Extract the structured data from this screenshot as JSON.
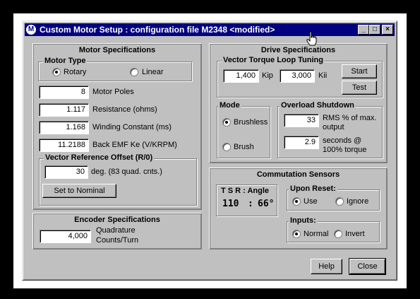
{
  "window": {
    "icon_glyph": "M",
    "title": "Custom Motor Setup : configuration file M2348  <modified>",
    "controls": {
      "minimize": "_",
      "maximize": "□",
      "close": "×"
    }
  },
  "motor_spec": {
    "title": "Motor Specifications",
    "motor_type": {
      "label": "Motor Type",
      "options": [
        {
          "label": "Rotary",
          "selected": true
        },
        {
          "label": "Linear",
          "selected": false
        }
      ]
    },
    "params": [
      {
        "value": "8",
        "label": "Motor Poles"
      },
      {
        "value": "1.117",
        "label": "Resistance (ohms)"
      },
      {
        "value": "1.168",
        "label": "Winding Constant (ms)"
      },
      {
        "value": "11.2188",
        "label": "Back EMF Ke (V/KRPM)"
      }
    ],
    "vector_offset": {
      "label": "Vector Reference Offset (R/0)",
      "value": "30",
      "unit": "deg. (83 quad. cnts.)",
      "button": "Set to Nominal"
    }
  },
  "encoder_spec": {
    "title": "Encoder Specifications",
    "value": "4,000",
    "label_line1": "Quadrature",
    "label_line2": "Counts/Turn"
  },
  "drive_spec": {
    "title": "Drive Specifications",
    "vector_loop": {
      "label": "Vector Torque Loop Tuning",
      "kip_value": "1,400",
      "kip_label": "Kip",
      "kii_value": "3,000",
      "kii_label": "Kii",
      "start_button": "Start",
      "test_button": "Test"
    },
    "mode": {
      "label": "Mode",
      "options": [
        {
          "label": "Brushless",
          "selected": true
        },
        {
          "label": "Brush",
          "selected": false
        }
      ]
    },
    "overload": {
      "label": "Overload Shutdown",
      "rms_value": "33",
      "rms_label_line1": "RMS % of max.",
      "rms_label_line2": "output",
      "sec_value": "2.9",
      "sec_label_line1": "seconds @",
      "sec_label_line2": "100% torque"
    }
  },
  "commutation": {
    "title": "Commutation Sensors",
    "tsr_label": "T S R :  Angle",
    "tsr_value": "110",
    "tsr_sep": ":",
    "angle_value": "66°",
    "upon_reset": {
      "label": "Upon Reset:",
      "options": [
        {
          "label": "Use",
          "selected": true
        },
        {
          "label": "Ignore",
          "selected": false
        }
      ]
    },
    "inputs": {
      "label": "Inputs:",
      "options": [
        {
          "label": "Normal",
          "selected": true
        },
        {
          "label": "Invert",
          "selected": false
        }
      ]
    }
  },
  "footer": {
    "help_button": "Help",
    "close_button": "Close"
  }
}
